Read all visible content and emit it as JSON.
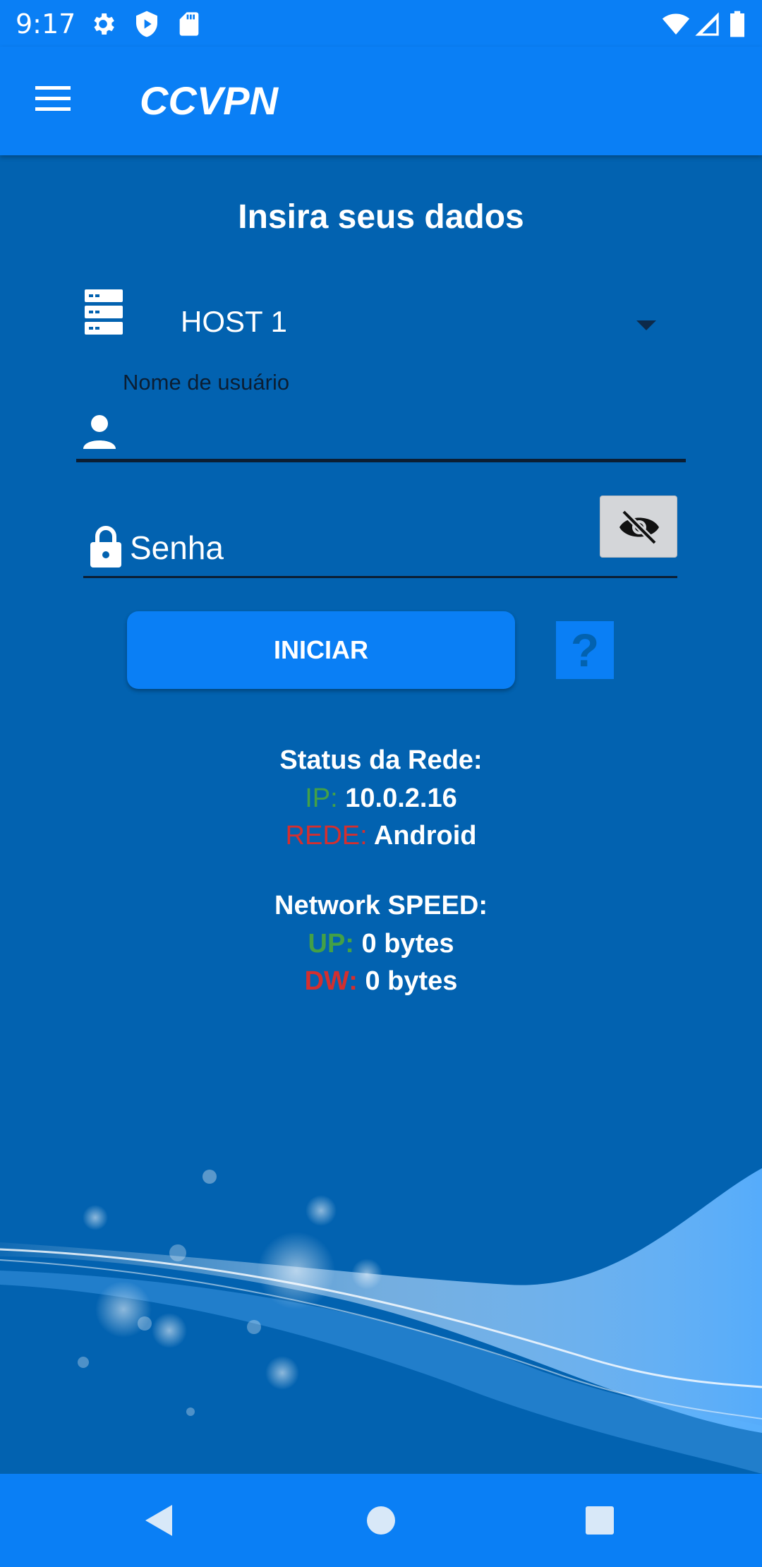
{
  "status_bar": {
    "time": "9:17",
    "left_icons": [
      "gear-icon",
      "shield-play-icon",
      "sd-card-icon"
    ],
    "right_icons": [
      "wifi-icon",
      "signal-icon",
      "battery-icon"
    ]
  },
  "app_bar": {
    "title": "CCVPN",
    "menu_icon": "hamburger-menu-icon"
  },
  "form": {
    "heading": "Insira seus dados",
    "host_selected": "HOST 1",
    "username_label": "Nome de usuário",
    "username_value": "",
    "password_placeholder": "Senha",
    "start_label": "INICIAR",
    "help_label": "?"
  },
  "network_status": {
    "title": "Status da Rede:",
    "ip_label": "IP:",
    "ip_value": "10.0.2.16",
    "network_label": "REDE:",
    "network_value": "Android"
  },
  "network_speed": {
    "title": "Network SPEED:",
    "up_label": "UP:",
    "up_value": "0 bytes",
    "down_label": "DW:",
    "down_value": "0 bytes"
  },
  "colors": {
    "accent": "#0a7ff5",
    "background": "#0262b0",
    "label_green": "#43a047",
    "label_red": "#d32f2f"
  },
  "nav_bar": {
    "buttons": [
      "back-icon",
      "home-icon",
      "recents-icon"
    ]
  }
}
